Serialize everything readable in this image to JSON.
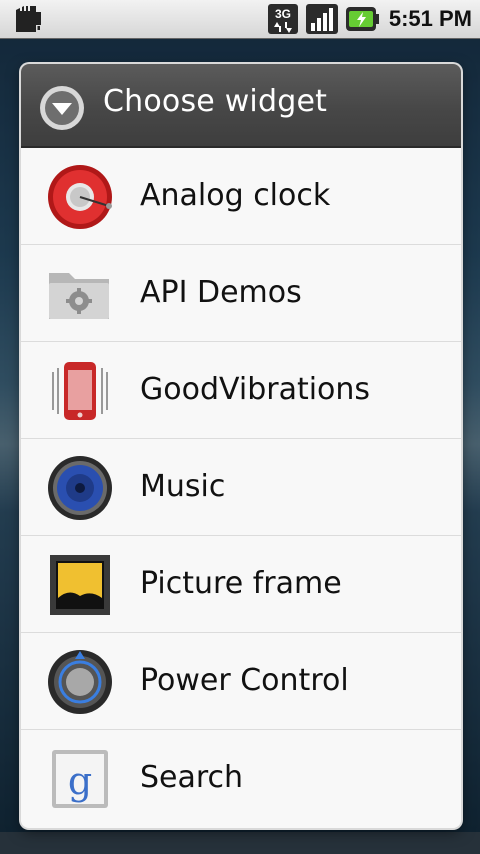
{
  "status_bar": {
    "network": "3G",
    "time": "5:51 PM"
  },
  "dialog": {
    "title": "Choose widget",
    "items": [
      {
        "label": "Analog clock",
        "icon": "analog-clock-icon"
      },
      {
        "label": "API Demos",
        "icon": "folder-gear-icon"
      },
      {
        "label": "GoodVibrations",
        "icon": "vibrating-phone-icon"
      },
      {
        "label": "Music",
        "icon": "speaker-icon"
      },
      {
        "label": "Picture frame",
        "icon": "picture-frame-icon"
      },
      {
        "label": "Power Control",
        "icon": "power-control-icon"
      },
      {
        "label": "Search",
        "icon": "google-search-icon"
      }
    ]
  },
  "colors": {
    "header_bg": "#474747",
    "list_bg": "#f8f8f8",
    "divider": "#dcdcdc"
  }
}
